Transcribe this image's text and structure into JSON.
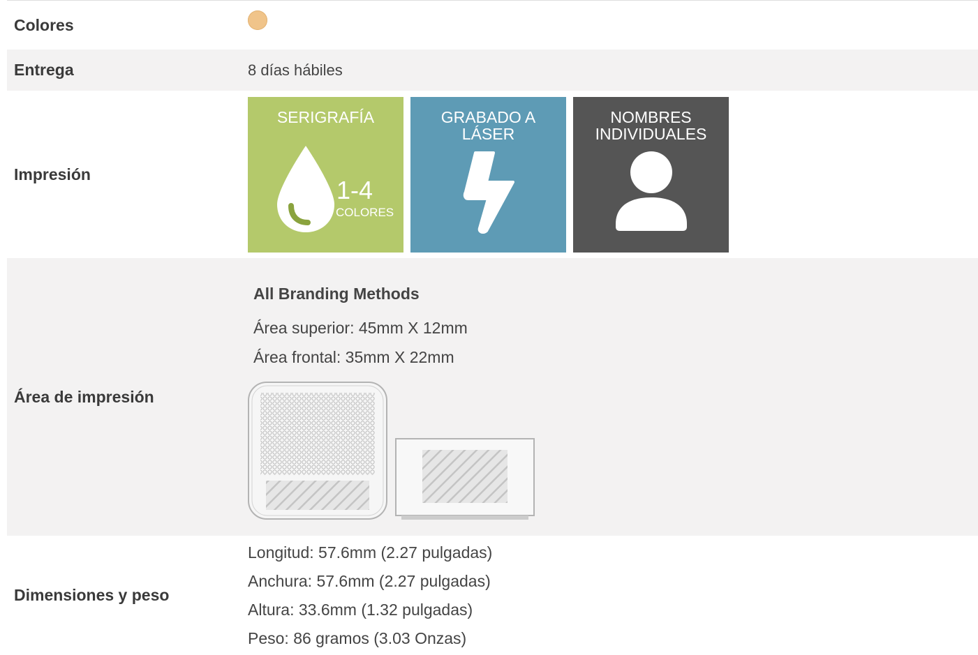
{
  "rows": {
    "colors": {
      "label": "Colores",
      "swatch_color": "#f0c48a"
    },
    "delivery": {
      "label": "Entrega",
      "value": "8 días hábiles"
    },
    "printing": {
      "label": "Impresión",
      "tiles": [
        {
          "title": "SERIGRAFÍA",
          "number": "1-4",
          "subtitle": "COLORES",
          "color": "#b4c96b",
          "icon": "ink-drop-icon"
        },
        {
          "title_line1": "GRABADO A",
          "title_line2": "LÁSER",
          "color": "#5e9bb5",
          "icon": "lightning-bolt-icon"
        },
        {
          "title_line1": "NOMBRES",
          "title_line2": "INDIVIDUALES",
          "color": "#555555",
          "icon": "user-icon"
        }
      ]
    },
    "print_area": {
      "label": "Área de impresión",
      "heading": "All Branding Methods",
      "lines": [
        "Área superior: 45mm X 12mm",
        "Área frontal: 35mm X 22mm"
      ]
    },
    "dimensions": {
      "label": "Dimensiones y peso",
      "lines": [
        "Longitud: 57.6mm (2.27 pulgadas)",
        "Anchura: 57.6mm (2.27 pulgadas)",
        "Altura: 33.6mm (1.32 pulgadas)",
        "Peso: 86 gramos (3.03 Onzas)"
      ]
    }
  }
}
